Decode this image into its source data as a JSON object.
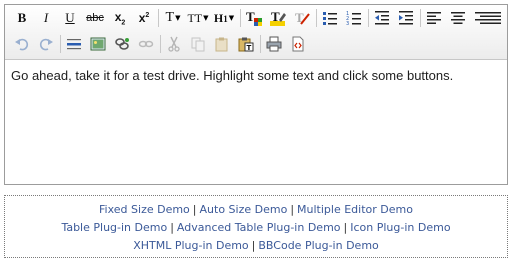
{
  "editor": {
    "content": "Go ahead, take it for a test drive. Highlight some text and click some buttons."
  },
  "toolbar": {
    "bold": "B",
    "italic": "I",
    "underline": "U",
    "strikethrough": "abc",
    "subscript": "x",
    "subscript_mark": "2",
    "superscript": "x",
    "superscript_mark": "2",
    "font_family": "T",
    "font_size": "TT",
    "heading": "H",
    "heading_mark": "1"
  },
  "demo_links": {
    "line1": [
      "Fixed Size Demo",
      "Auto Size Demo",
      "Multiple Editor Demo"
    ],
    "line2": [
      "Table Plug-in Demo",
      "Advanced Table Plug-in Demo",
      "Icon Plug-in Demo"
    ],
    "line3": [
      "XHTML Plug-in Demo",
      "BBCode Plug-in Demo"
    ],
    "separator": "|"
  },
  "colors": {
    "link": "#3b5998",
    "accent_red": "#cc2200",
    "accent_blue": "#2a5db0",
    "highlight_yellow": "#f5d000"
  }
}
